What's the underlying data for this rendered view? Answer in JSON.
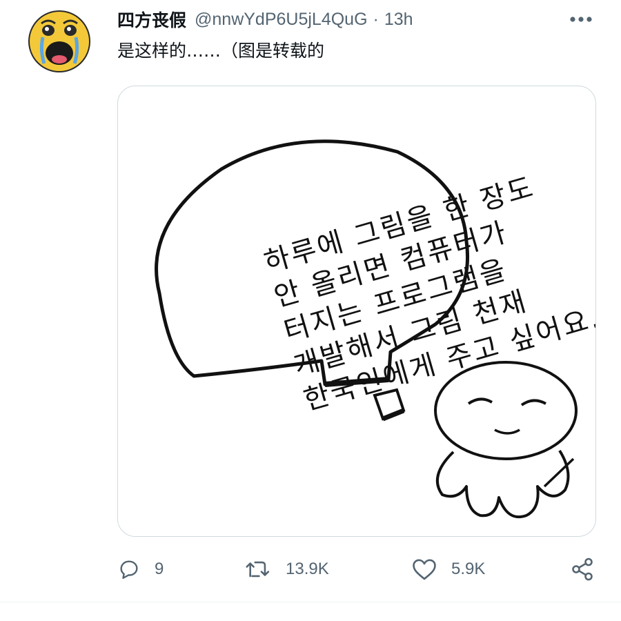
{
  "tweet": {
    "display_name": "四方丧假",
    "handle": "@nnwYdP6U5jL4QuG",
    "separator": "·",
    "time": "13h",
    "text": "是这样的……（图是转载的"
  },
  "avatar": {
    "icon": "crying-emoji-avatar",
    "face_color": "#f3c93a"
  },
  "more_icon": "more-horizontal-icon",
  "media": {
    "comic_text_lines": [
      "하루에 그림을 한 장도",
      "안 올리면 컴퓨터가",
      "터지는 프로그램을",
      "개발해서 그림 천재",
      "한국인에게 주고 싶어요."
    ]
  },
  "actions": {
    "reply": {
      "icon": "reply-icon",
      "count": "9"
    },
    "retweet": {
      "icon": "retweet-icon",
      "count": "13.9K"
    },
    "like": {
      "icon": "heart-icon",
      "count": "5.9K"
    },
    "share": {
      "icon": "share-icon"
    }
  },
  "colors": {
    "text_primary": "#0f1419",
    "text_secondary": "#536471",
    "border": "#cfd9de"
  }
}
